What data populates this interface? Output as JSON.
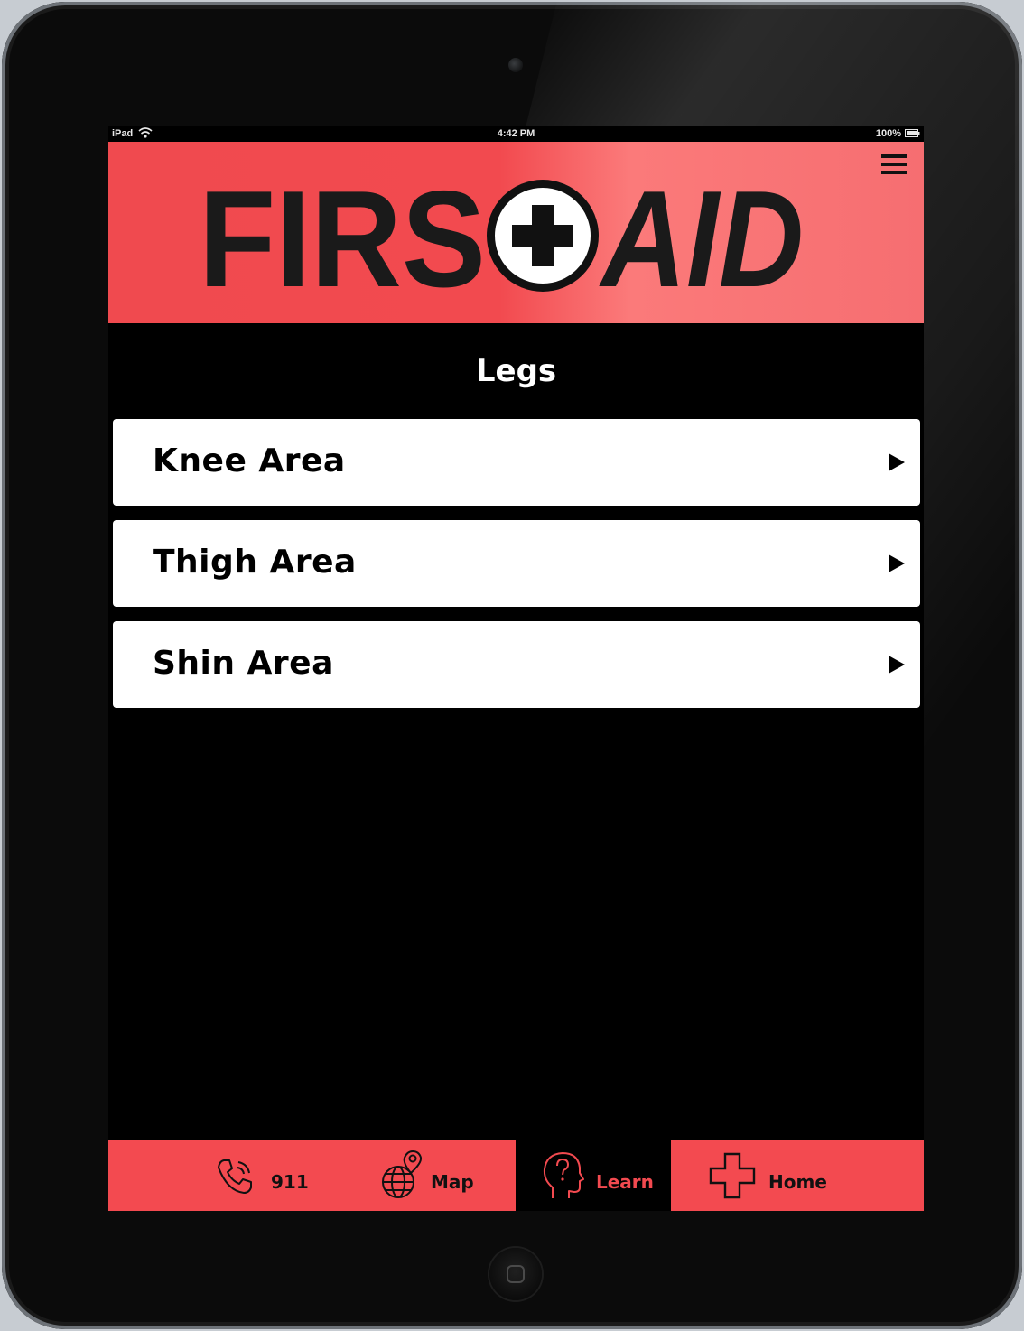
{
  "status_bar": {
    "carrier": "iPad",
    "time": "4:42 PM",
    "battery": "100%"
  },
  "header": {
    "logo_text_left": "FIRS",
    "logo_text_right": "AID",
    "brand_color": "#f34a50"
  },
  "page": {
    "title": "Legs"
  },
  "list": {
    "items": [
      {
        "label": "Knee Area"
      },
      {
        "label": "Thigh Area"
      },
      {
        "label": "Shin Area"
      }
    ]
  },
  "tabbar": {
    "tabs": [
      {
        "label": "911",
        "icon": "phone-icon",
        "active": false
      },
      {
        "label": "Map",
        "icon": "globe-pin-icon",
        "active": false
      },
      {
        "label": "Learn",
        "icon": "head-question-icon",
        "active": true
      },
      {
        "label": "Home",
        "icon": "cross-icon",
        "active": false
      }
    ]
  }
}
